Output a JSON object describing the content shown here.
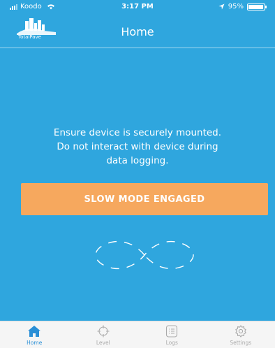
{
  "status_bar": {
    "carrier": "Koodo",
    "time": "3:17 PM",
    "battery": "95%",
    "battery_level": 0.95
  },
  "header": {
    "logo_text": "TotalPave",
    "title": "Home"
  },
  "message": {
    "lines": [
      "Ensure device is securely mounted.",
      "Do not interact with device during",
      "data logging."
    ]
  },
  "mode_button": {
    "label": "SLOW MODE ENGAGED"
  },
  "tabs": [
    {
      "label": "Home",
      "icon": "home-icon",
      "active": true
    },
    {
      "label": "Level",
      "icon": "crosshair-icon",
      "active": false
    },
    {
      "label": "Logs",
      "icon": "list-icon",
      "active": false
    },
    {
      "label": "Settings",
      "icon": "gear-icon",
      "active": false
    }
  ],
  "colors": {
    "background": "#2fa6de",
    "button": "#f6a85e",
    "tab_active": "#2a8fd6",
    "tab_inactive": "#aaaaaa"
  }
}
